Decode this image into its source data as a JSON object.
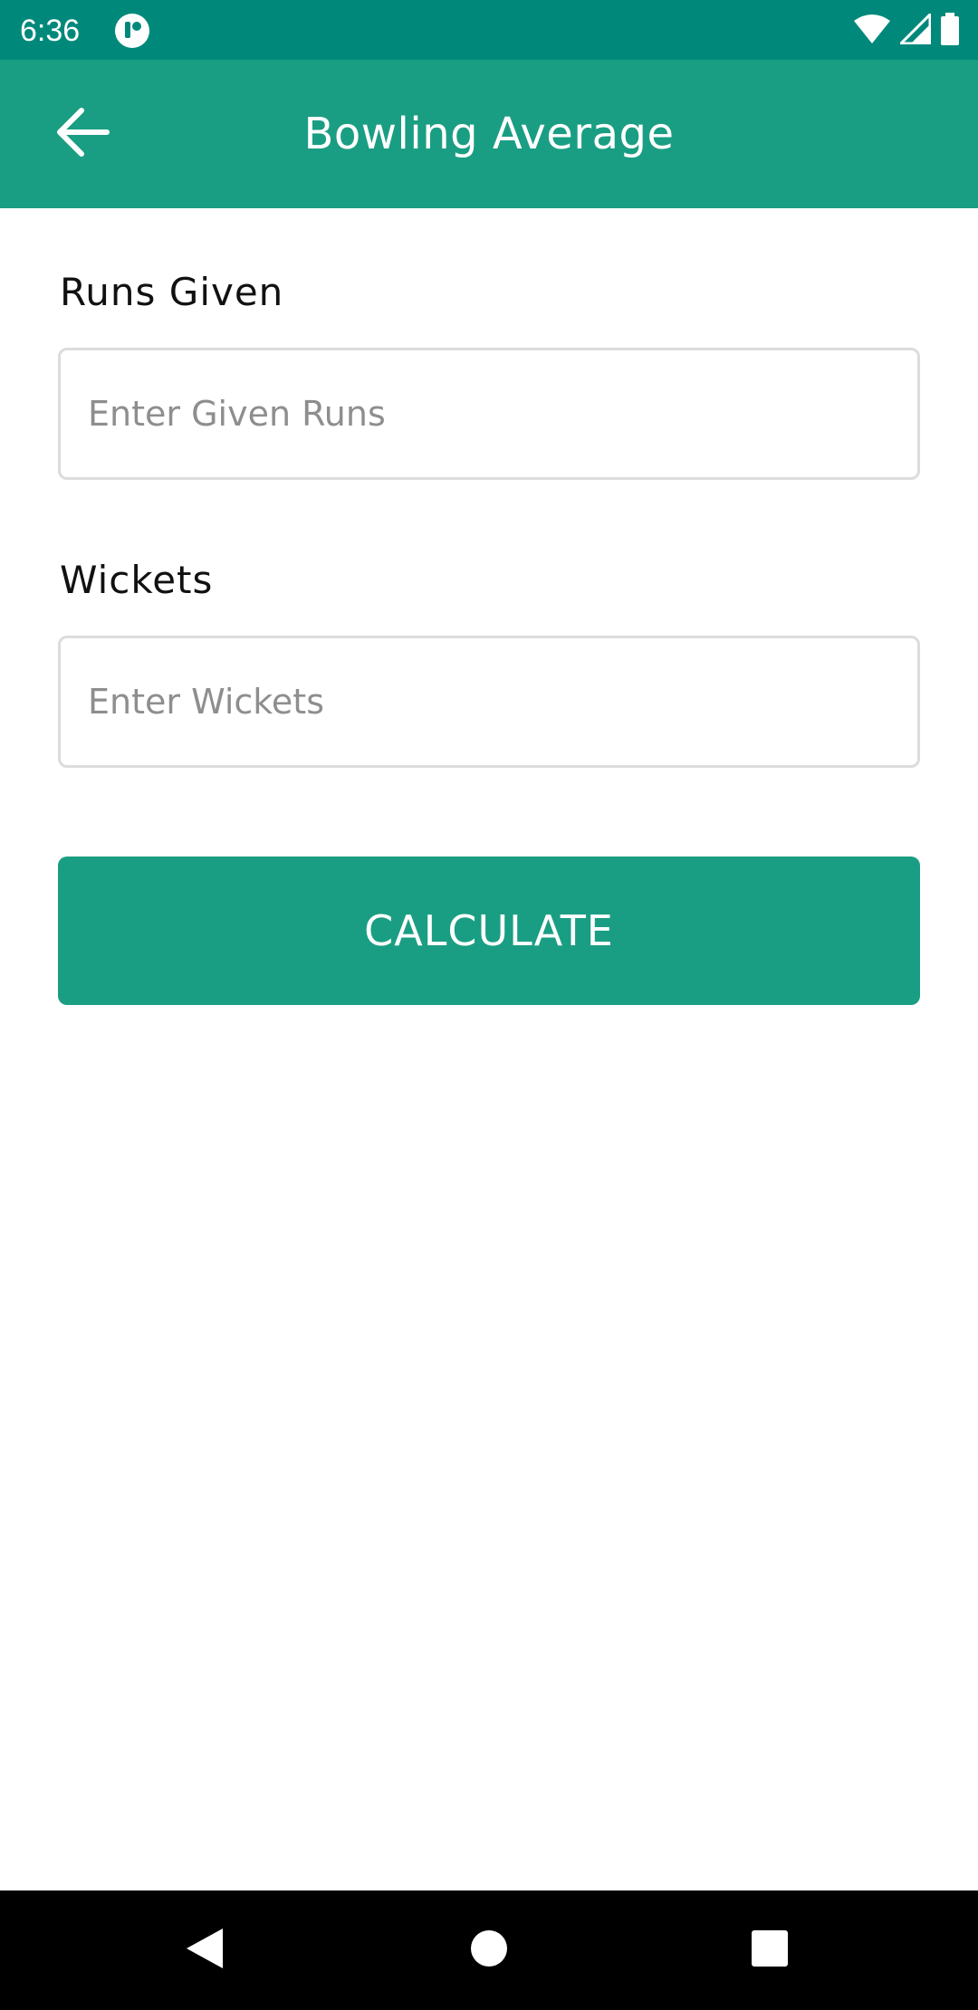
{
  "status_bar": {
    "time": "6:36",
    "background_color": "#00897b",
    "icons": [
      "app-notification-icon",
      "wifi-icon",
      "cell-signal-icon",
      "battery-icon"
    ]
  },
  "app_bar": {
    "title": "Bowling Average",
    "back_icon": "arrow-left-icon",
    "background_color": "#1a9e83"
  },
  "form": {
    "runs": {
      "label": "Runs Given",
      "value": "",
      "placeholder": "Enter Given Runs"
    },
    "wickets": {
      "label": "Wickets",
      "value": "",
      "placeholder": "Enter Wickets"
    },
    "calculate_label": "CALCULATE"
  },
  "nav_bar": {
    "icons": [
      "back-triangle-icon",
      "home-circle-icon",
      "recents-square-icon"
    ]
  }
}
